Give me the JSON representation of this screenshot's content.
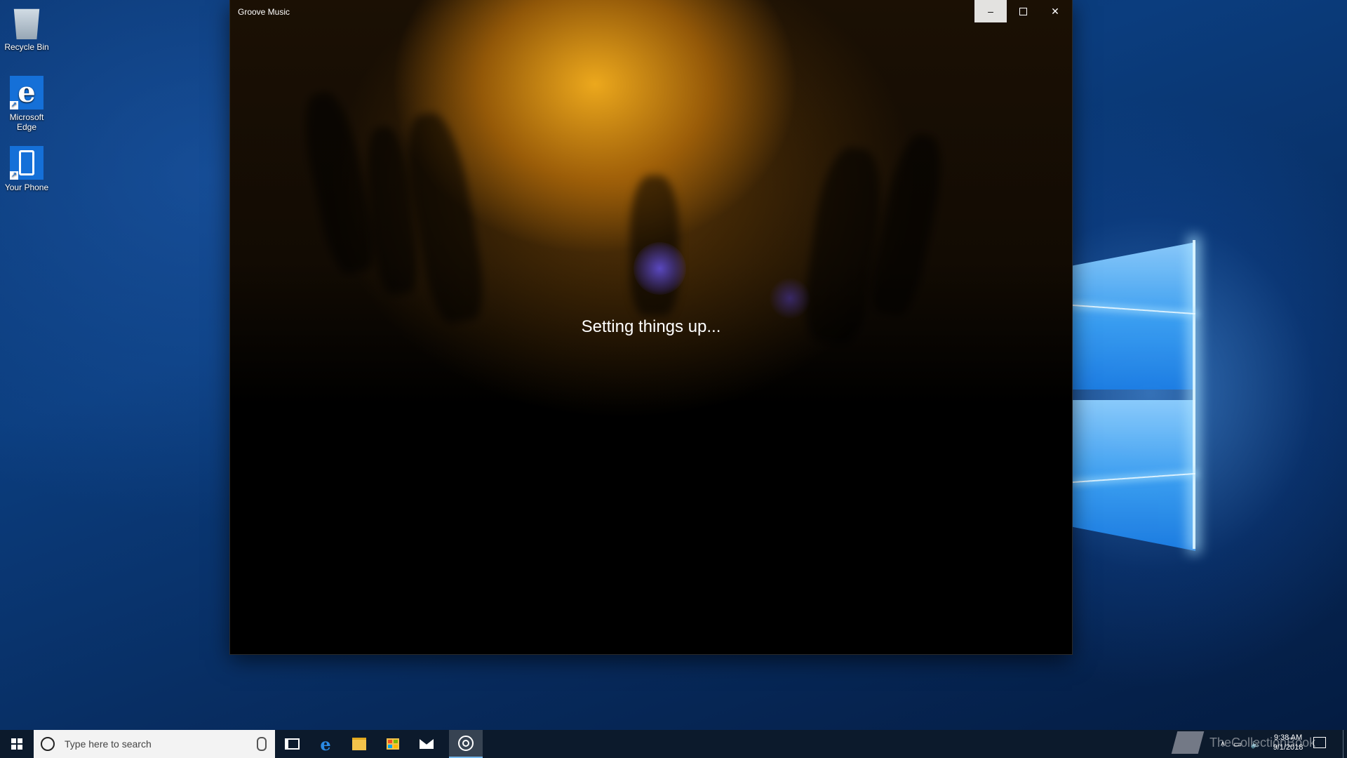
{
  "desktop": {
    "icons": [
      {
        "label": "Recycle Bin"
      },
      {
        "label": "Microsoft Edge"
      },
      {
        "label": "Your Phone"
      }
    ]
  },
  "window": {
    "title": "Groove Music",
    "status_text": "Setting things up...",
    "controls": {
      "minimize": "minimize-icon",
      "maximize": "maximize-icon",
      "close": "close-icon"
    }
  },
  "taskbar": {
    "search_placeholder": "Type here to search",
    "pinned": [
      "task-view-icon",
      "edge-icon",
      "file-explorer-icon",
      "store-icon",
      "mail-icon",
      "groove-music-icon"
    ],
    "active_app": "groove-music-icon",
    "watermark": "TheCollectionBook",
    "clock": {
      "time": "9:38 AM",
      "date": "9/1/2018"
    }
  },
  "colors": {
    "accent": "#76b9ed",
    "taskbar": "#0c1a2c"
  }
}
